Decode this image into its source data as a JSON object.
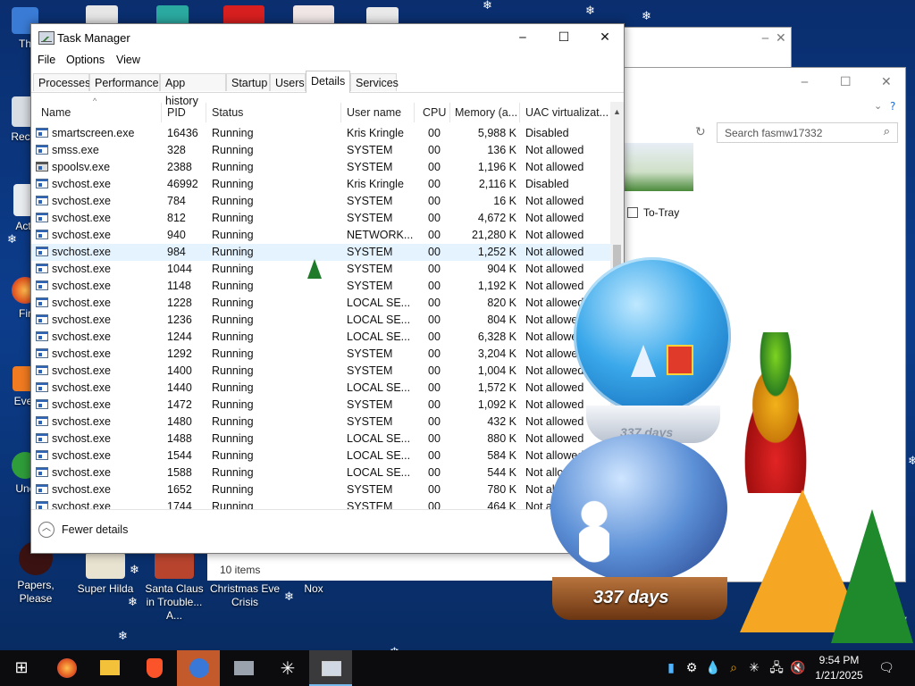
{
  "desktop": {
    "icons": [
      {
        "label": "Th"
      },
      {
        "label": "Recy"
      },
      {
        "label": "Act"
      },
      {
        "label": "Fir"
      },
      {
        "label": "Ever"
      },
      {
        "label": "Unc"
      },
      {
        "label": "Papers, Please"
      },
      {
        "label": "Super Hilda"
      },
      {
        "label": "Santa Claus in Trouble... A..."
      },
      {
        "label": "Christmas Eve Crisis"
      },
      {
        "label": "Nox"
      }
    ],
    "globe_text_top": "337 days",
    "globe_text_bottom": "337 days"
  },
  "explorer": {
    "search_placeholder": "Search fasmw17332",
    "status": "10 items",
    "to_tray": "To-Tray"
  },
  "task_manager": {
    "title": "Task Manager",
    "menu": [
      "File",
      "Options",
      "View"
    ],
    "tabs": [
      "Processes",
      "Performance",
      "App history",
      "Startup",
      "Users",
      "Details",
      "Services"
    ],
    "active_tab": "Details",
    "columns": [
      "Name",
      "PID",
      "Status",
      "User name",
      "CPU",
      "Memory (a...",
      "UAC virtualizat..."
    ],
    "rows": [
      {
        "name": "smartscreen.exe",
        "pid": "16436",
        "status": "Running",
        "user": "Kris Kringle",
        "cpu": "00",
        "mem": "5,988 K",
        "uac": "Disabled",
        "icon": "app"
      },
      {
        "name": "smss.exe",
        "pid": "328",
        "status": "Running",
        "user": "SYSTEM",
        "cpu": "00",
        "mem": "136 K",
        "uac": "Not allowed",
        "icon": "app"
      },
      {
        "name": "spoolsv.exe",
        "pid": "2388",
        "status": "Running",
        "user": "SYSTEM",
        "cpu": "00",
        "mem": "1,196 K",
        "uac": "Not allowed",
        "icon": "printer"
      },
      {
        "name": "svchost.exe",
        "pid": "46992",
        "status": "Running",
        "user": "Kris Kringle",
        "cpu": "00",
        "mem": "2,116 K",
        "uac": "Disabled",
        "icon": "app"
      },
      {
        "name": "svchost.exe",
        "pid": "784",
        "status": "Running",
        "user": "SYSTEM",
        "cpu": "00",
        "mem": "16 K",
        "uac": "Not allowed",
        "icon": "app"
      },
      {
        "name": "svchost.exe",
        "pid": "812",
        "status": "Running",
        "user": "SYSTEM",
        "cpu": "00",
        "mem": "4,672 K",
        "uac": "Not allowed",
        "icon": "app"
      },
      {
        "name": "svchost.exe",
        "pid": "940",
        "status": "Running",
        "user": "NETWORK...",
        "cpu": "00",
        "mem": "21,280 K",
        "uac": "Not allowed",
        "icon": "app"
      },
      {
        "name": "svchost.exe",
        "pid": "984",
        "status": "Running",
        "user": "SYSTEM",
        "cpu": "00",
        "mem": "1,252 K",
        "uac": "Not allowed",
        "icon": "app",
        "selected": true
      },
      {
        "name": "svchost.exe",
        "pid": "1044",
        "status": "Running",
        "user": "SYSTEM",
        "cpu": "00",
        "mem": "904 K",
        "uac": "Not allowed",
        "icon": "app"
      },
      {
        "name": "svchost.exe",
        "pid": "1148",
        "status": "Running",
        "user": "SYSTEM",
        "cpu": "00",
        "mem": "1,192 K",
        "uac": "Not allowed",
        "icon": "app"
      },
      {
        "name": "svchost.exe",
        "pid": "1228",
        "status": "Running",
        "user": "LOCAL SE...",
        "cpu": "00",
        "mem": "820 K",
        "uac": "Not allowed",
        "icon": "app"
      },
      {
        "name": "svchost.exe",
        "pid": "1236",
        "status": "Running",
        "user": "LOCAL SE...",
        "cpu": "00",
        "mem": "804 K",
        "uac": "Not allowed",
        "icon": "app"
      },
      {
        "name": "svchost.exe",
        "pid": "1244",
        "status": "Running",
        "user": "LOCAL SE...",
        "cpu": "00",
        "mem": "6,328 K",
        "uac": "Not allowed",
        "icon": "app"
      },
      {
        "name": "svchost.exe",
        "pid": "1292",
        "status": "Running",
        "user": "SYSTEM",
        "cpu": "00",
        "mem": "3,204 K",
        "uac": "Not allowed",
        "icon": "app"
      },
      {
        "name": "svchost.exe",
        "pid": "1400",
        "status": "Running",
        "user": "SYSTEM",
        "cpu": "00",
        "mem": "1,004 K",
        "uac": "Not allowed",
        "icon": "app"
      },
      {
        "name": "svchost.exe",
        "pid": "1440",
        "status": "Running",
        "user": "LOCAL SE...",
        "cpu": "00",
        "mem": "1,572 K",
        "uac": "Not allowed",
        "icon": "app"
      },
      {
        "name": "svchost.exe",
        "pid": "1472",
        "status": "Running",
        "user": "SYSTEM",
        "cpu": "00",
        "mem": "1,092 K",
        "uac": "Not allowed",
        "icon": "app"
      },
      {
        "name": "svchost.exe",
        "pid": "1480",
        "status": "Running",
        "user": "SYSTEM",
        "cpu": "00",
        "mem": "432 K",
        "uac": "Not allowed",
        "icon": "app"
      },
      {
        "name": "svchost.exe",
        "pid": "1488",
        "status": "Running",
        "user": "LOCAL SE...",
        "cpu": "00",
        "mem": "880 K",
        "uac": "Not allowed",
        "icon": "app"
      },
      {
        "name": "svchost.exe",
        "pid": "1544",
        "status": "Running",
        "user": "LOCAL SE...",
        "cpu": "00",
        "mem": "584 K",
        "uac": "Not allowed",
        "icon": "app"
      },
      {
        "name": "svchost.exe",
        "pid": "1588",
        "status": "Running",
        "user": "LOCAL SE...",
        "cpu": "00",
        "mem": "544 K",
        "uac": "Not allowed",
        "icon": "app"
      },
      {
        "name": "svchost.exe",
        "pid": "1652",
        "status": "Running",
        "user": "SYSTEM",
        "cpu": "00",
        "mem": "780 K",
        "uac": "Not allowed",
        "icon": "app"
      },
      {
        "name": "svchost.exe",
        "pid": "1744",
        "status": "Running",
        "user": "SYSTEM",
        "cpu": "00",
        "mem": "464 K",
        "uac": "Not allowed",
        "icon": "app"
      }
    ],
    "fewer_details": "Fewer details"
  },
  "taskbar": {
    "time": "9:54 PM",
    "date": "1/21/2025"
  }
}
